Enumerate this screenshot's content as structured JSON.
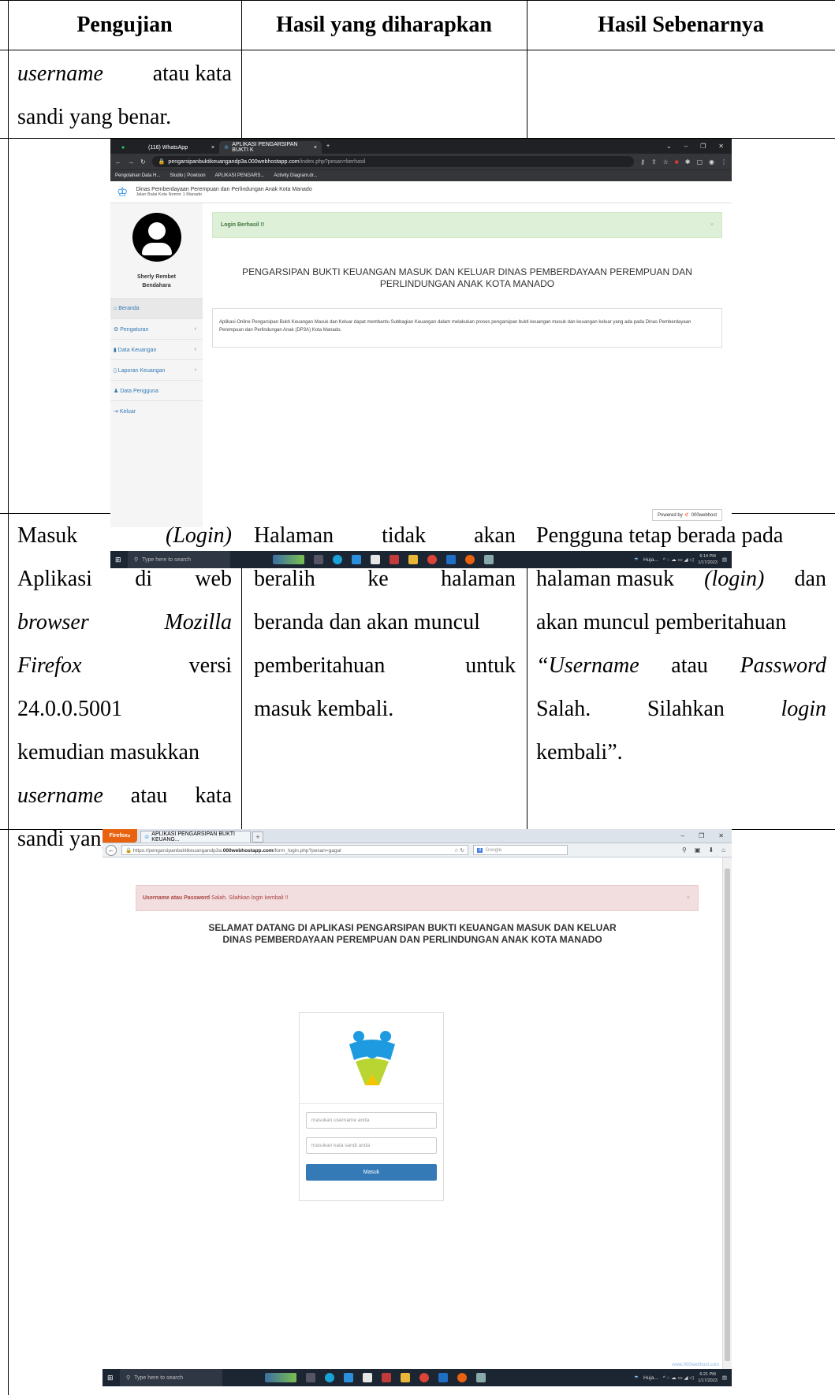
{
  "table": {
    "headers": [
      "Pengujian",
      "Hasil yang diharapkan",
      "Hasil Sebenarnya"
    ],
    "row1_col1": [
      "username atau kata",
      "sandi yang benar."
    ],
    "row2": {
      "col1": [
        [
          "Masuk",
          "(Login)"
        ],
        [
          "Aplikasi",
          "di",
          "web"
        ],
        [
          "browser",
          "Mozilla"
        ],
        [
          "Firefox",
          "versi"
        ],
        [
          "24.0.0.5001"
        ],
        [
          "kemudian masukkan"
        ],
        [
          "username",
          "atau",
          "kata"
        ],
        [
          "sandi yang salah."
        ]
      ],
      "col2": [
        [
          "Halaman",
          "tidak",
          "akan"
        ],
        [
          "beralih",
          "ke",
          "halaman"
        ],
        [
          "beranda dan akan muncul"
        ],
        [
          "pemberitahuan",
          "untuk"
        ],
        [
          "masuk kembali."
        ]
      ],
      "col3": [
        [
          "Pengguna tetap berada pada"
        ],
        [
          "halaman masuk",
          "(login)",
          "dan"
        ],
        [
          "akan muncul pemberitahuan"
        ],
        [
          "“Username",
          "atau",
          "Password"
        ],
        [
          "Salah.",
          "Silahkan",
          "login"
        ],
        [
          "kembali”."
        ]
      ]
    }
  },
  "screenshot1": {
    "tabs": [
      "(116) WhatsApp",
      "APLIKASI PENGARSIPAN BUKTI K"
    ],
    "url_host": "pengarsipanbuktikeuangandp3a.000webhostapp.com",
    "url_path": "/index.php?pesan=berhasil",
    "bookmarks": [
      "Pengolahan Data H...",
      "Studio | Powtoon",
      "APLIKASI PENGARS...",
      "Activity Diagram.dr..."
    ],
    "org_name": "Dinas Pemberdayaan Perempuan dan Perlindungan Anak Kota Manado",
    "org_address": "Jalan Balai Kota Nomor 1 Manado",
    "user_name": "Sherly Rembet",
    "user_role": "Bendahara",
    "menu": [
      "Beranda",
      "Pengaturan",
      "Data Keuangan",
      "Laporan Keuangan",
      "Data Pengguna",
      "Keluar"
    ],
    "alert": "Login Berhasil !!",
    "title": "PENGARSIPAN BUKTI KEUANGAN MASUK DAN KELUAR DINAS PEMBERDAYAAN PEREMPUAN DAN PERLINDUNGAN ANAK KOTA MANADO",
    "description": "Aplikasi Online Pengarsipan Bukti Keuangan Masuk dan Keluar dapat membantu Subbagian Keuangan dalam melakukan proses pengarsipan bukti keuangan masuk dan keuangan keluar yang ada pada Dinas Pemberdayaan Perempuan dan Perlindungan Anak (DP3A) Kota Manado.",
    "powered_by": "Powered by",
    "powered_brand": "000webhost",
    "taskbar_search": "Type here to search",
    "tray_text": "Huja...",
    "clock_time": "6:14 PM",
    "clock_date": "1/17/2023"
  },
  "screenshot2": {
    "firefox_btn": "Firefox",
    "tab": "APLIKASI PENGARSIPAN BUKTI KEUANG...",
    "url_prefix": "https://pengarsipanbuktikeuangandp3a.",
    "url_host": "000webhostapp.com",
    "url_path": "/form_login.php?pesan=gagal",
    "search_engine": "Google",
    "alert_bold": "Username atau Password",
    "alert_rest": "Salah. Silahkan login kembali !!",
    "title": "SELAMAT DATANG DI APLIKASI PENGARSIPAN BUKTI KEUANGAN MASUK DAN KELUAR DINAS PEMBERDAYAAN PEREMPUAN DAN PERLINDUNGAN ANAK KOTA MANADO",
    "username_placeholder": "masukan username anda",
    "password_placeholder": "masukan kata sandi anda",
    "submit_label": "Masuk",
    "watermark": "www.000webhost.com",
    "taskbar_search": "Type here to search",
    "tray_text": "Huja...",
    "clock_time": "6:21 PM",
    "clock_date": "1/17/2023"
  }
}
